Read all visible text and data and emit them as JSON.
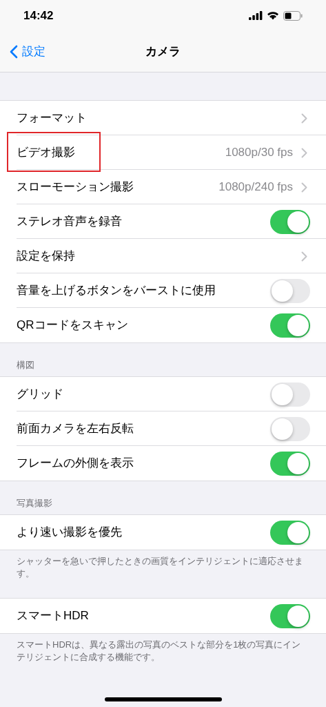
{
  "status_bar": {
    "time": "14:42"
  },
  "nav": {
    "back": "設定",
    "title": "カメラ"
  },
  "sections": [
    {
      "rows": [
        {
          "kind": "link",
          "label": "フォーマット",
          "highlighted": false
        },
        {
          "kind": "link",
          "label": "ビデオ撮影",
          "value": "1080p/30 fps",
          "highlighted": true
        },
        {
          "kind": "link",
          "label": "スローモーション撮影",
          "value": "1080p/240 fps",
          "highlighted": false
        },
        {
          "kind": "toggle",
          "label": "ステレオ音声を録音",
          "on": true,
          "highlighted": false
        },
        {
          "kind": "link",
          "label": "設定を保持",
          "highlighted": false
        },
        {
          "kind": "toggle",
          "label": "音量を上げるボタンをバーストに使用",
          "on": false,
          "highlighted": false
        },
        {
          "kind": "toggle",
          "label": "QRコードをスキャン",
          "on": true,
          "highlighted": false
        }
      ]
    },
    {
      "header": "構図",
      "rows": [
        {
          "kind": "toggle",
          "label": "グリッド",
          "on": false,
          "highlighted": false
        },
        {
          "kind": "toggle",
          "label": "前面カメラを左右反転",
          "on": false,
          "highlighted": false
        },
        {
          "kind": "toggle",
          "label": "フレームの外側を表示",
          "on": true,
          "highlighted": false
        }
      ]
    },
    {
      "header": "写真撮影",
      "rows": [
        {
          "kind": "toggle",
          "label": "より速い撮影を優先",
          "on": true,
          "highlighted": false
        }
      ],
      "footer": "シャッターを急いで押したときの画質をインテリジェントに適応させます。"
    },
    {
      "rows": [
        {
          "kind": "toggle",
          "label": "スマートHDR",
          "on": true,
          "highlighted": false
        }
      ],
      "footer": "スマートHDRは、異なる露出の写真のベストな部分を1枚の写真にインテリジェントに合成する機能です。"
    }
  ]
}
